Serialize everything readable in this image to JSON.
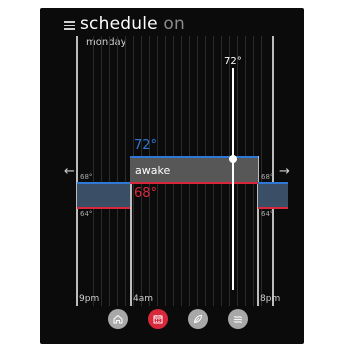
{
  "header": {
    "title": "schedule",
    "status": "on",
    "day": "monday"
  },
  "schedule": {
    "period_label": "awake",
    "cool_setpoint": "72°",
    "heat_setpoint": "68°",
    "left_cool_small": "68°",
    "left_heat_small": "64°",
    "right_cool_small": "68°",
    "right_heat_small": "64°",
    "current_temp": "72°"
  },
  "timeline": {
    "ticks": [
      "9pm",
      "4am",
      "8pm"
    ]
  },
  "nav": {
    "items": [
      "home",
      "schedule",
      "eco",
      "fan"
    ],
    "active": "schedule"
  },
  "colors": {
    "cool": "#2f78d6",
    "heat": "#d8283c",
    "background": "#0b0b0b"
  },
  "arrows": {
    "left": "←",
    "right": "→"
  }
}
